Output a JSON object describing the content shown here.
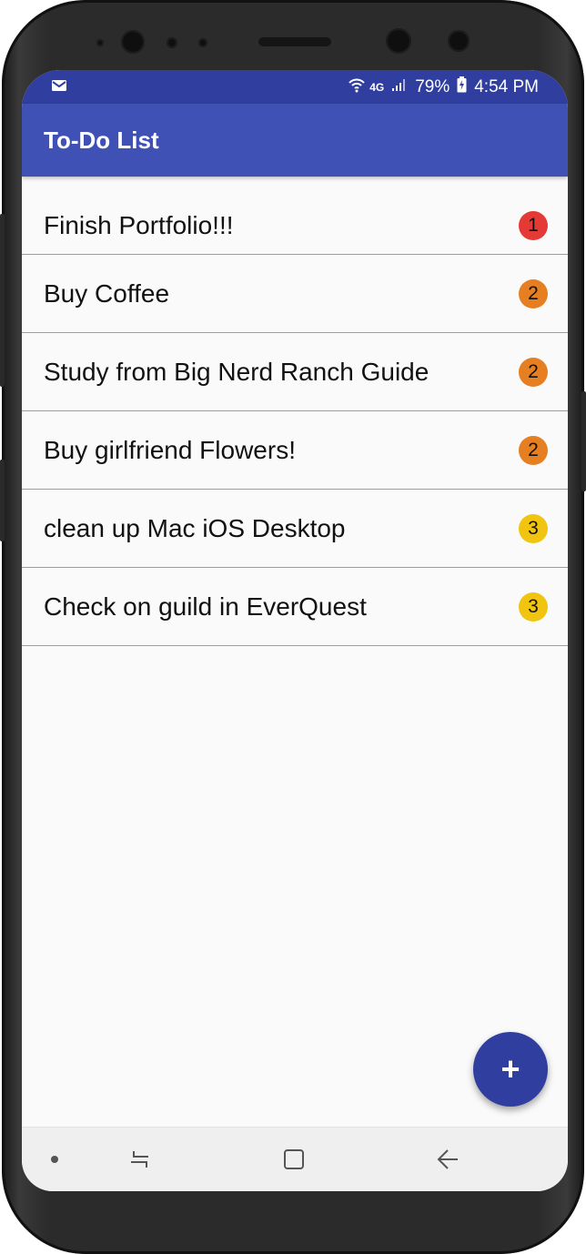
{
  "status_bar": {
    "network": "4G",
    "battery": "79%",
    "time": "4:54 PM",
    "notification_icon": "mail-icon"
  },
  "toolbar": {
    "title": "To-Do List"
  },
  "colors": {
    "primary": "#3f51b5",
    "primary_dark": "#303f9f",
    "priority_1": "#e53935",
    "priority_2": "#e67e22",
    "priority_3": "#f1c40f"
  },
  "todos": [
    {
      "title": "Finish Portfolio!!!",
      "priority": "1"
    },
    {
      "title": "Buy Coffee",
      "priority": "2"
    },
    {
      "title": "Study from Big Nerd Ranch Guide",
      "priority": "2"
    },
    {
      "title": "Buy girlfriend Flowers!",
      "priority": "2"
    },
    {
      "title": "clean up Mac iOS Desktop",
      "priority": "3"
    },
    {
      "title": "Check on guild in EverQuest",
      "priority": "3"
    }
  ],
  "fab": {
    "label": "+",
    "icon": "add-icon"
  },
  "nav_bar": [
    "dot-icon",
    "recents-icon",
    "home-icon",
    "back-icon"
  ]
}
